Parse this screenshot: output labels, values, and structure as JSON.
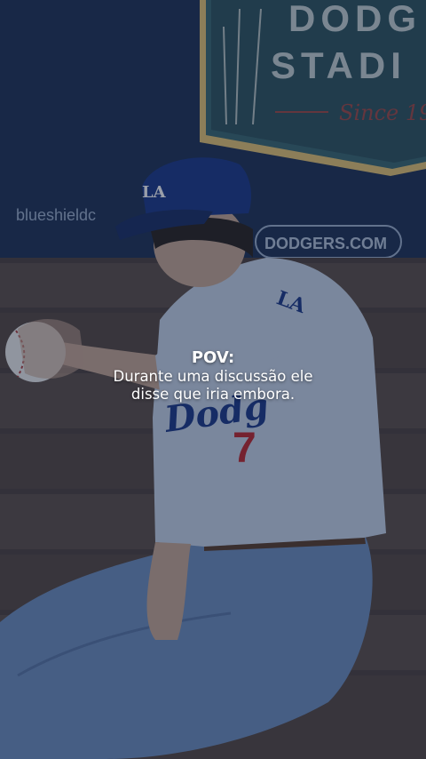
{
  "caption": {
    "title": "POV:",
    "line1": "Durante uma discussão ele",
    "line2": "disse que iria embora."
  },
  "scene": {
    "sign": {
      "line1": "DODG",
      "line2": "STADI",
      "script": "Since 19"
    },
    "wall_text_1": "blueshieldc",
    "wall_text_2": "DODGERS.COM",
    "cap_logo": "LA",
    "shirt_logo": "LA",
    "shirt_text": "Dodg",
    "shirt_number": "7"
  },
  "colors": {
    "wall": "#1f3356",
    "bench": "#5a4c46",
    "shirt": "#c9d6ea",
    "jeans": "#6f8fbf",
    "cap": "#1d3a8a",
    "overlay": "#0e1a33"
  }
}
